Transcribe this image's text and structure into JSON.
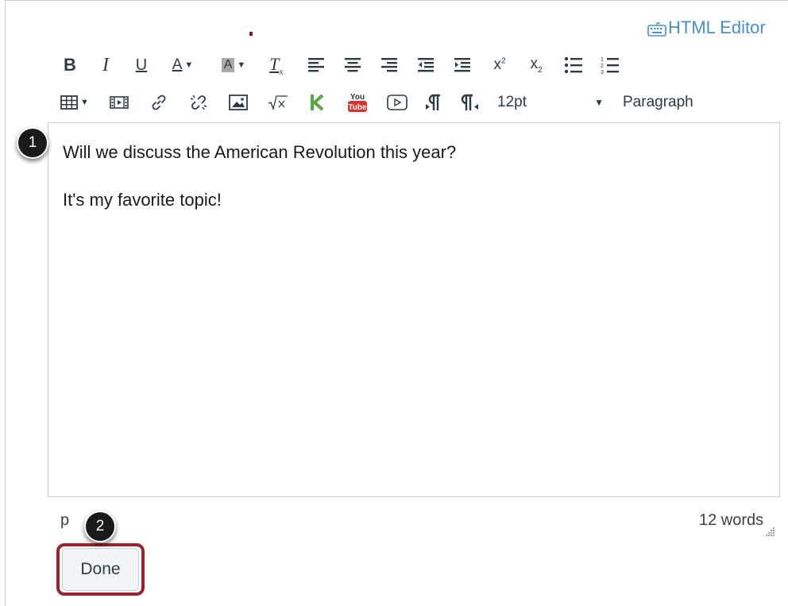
{
  "header": {
    "html_editor_label": "HTML Editor",
    "html_editor_icon": "keyboard-icon"
  },
  "toolbar": {
    "bold": "B",
    "italic": "I",
    "underline": "U",
    "font_color": "A",
    "background_color": "A",
    "clear_formatting": "T",
    "superscript": "x",
    "subscript": "x",
    "font_size": "12pt",
    "block_format": "Paragraph"
  },
  "editor": {
    "paragraphs": [
      "Will we discuss the American Revolution this year?",
      "It's my favorite topic!"
    ]
  },
  "status": {
    "path": "p",
    "word_count": "12 words"
  },
  "actions": {
    "done_label": "Done"
  },
  "callouts": {
    "first": "1",
    "second": "2"
  },
  "colors": {
    "accent_link": "#4b8dc8",
    "highlight_border": "#97232d",
    "kaltura_green": "#5ca444",
    "youtube_red": "#d9322c"
  }
}
